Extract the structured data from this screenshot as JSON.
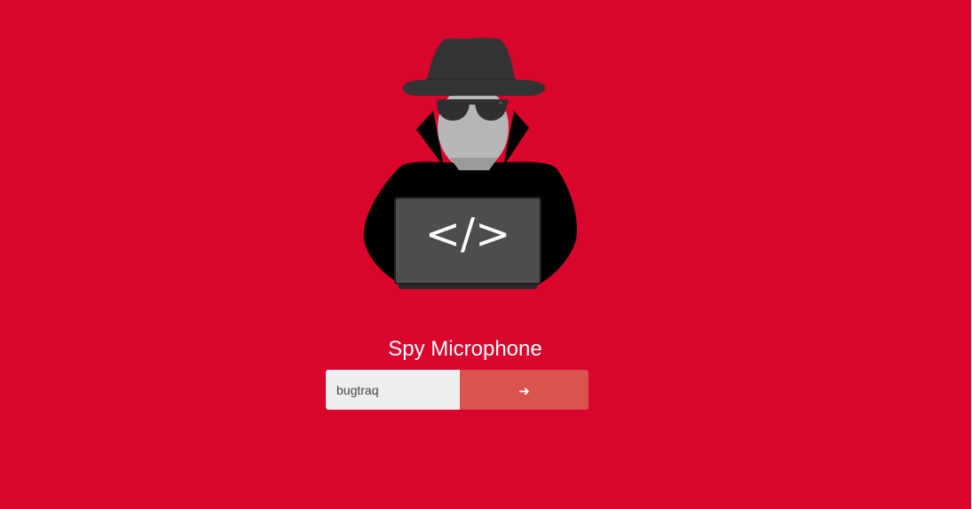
{
  "app": {
    "title": "Spy Microphone"
  },
  "illustration": {
    "laptop_text": "</>"
  },
  "login": {
    "name_value": "bugtraq",
    "submit_icon": "arrow-right-icon",
    "submit_glyph": "➜"
  },
  "colors": {
    "background": "#da052d",
    "input_background": "#efefef",
    "button_background": "#d9534f",
    "text": "#ffffff"
  }
}
